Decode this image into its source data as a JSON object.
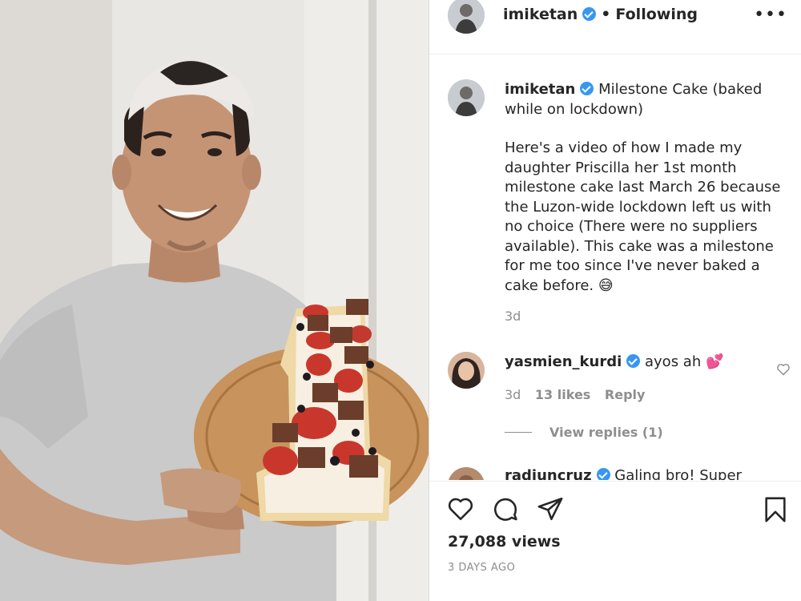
{
  "post": {
    "username": "imiketan",
    "follow_status": "Following",
    "more_icon": "more-options-icon"
  },
  "caption": {
    "username": "imiketan",
    "title": "Milestone Cake (baked while on lockdown)",
    "body": "Here's a video of how I made my daughter Priscilla her 1st month milestone cake last March 26 because the Luzon-wide lockdown left us with no choice (There were no suppliers available). This cake was a milestone for me too since I've never baked a cake before. 😅",
    "time": "3d"
  },
  "comments": [
    {
      "username": "yasmien_kurdi",
      "text": "ayos ah 💕",
      "time": "3d",
      "likes": "13 likes",
      "reply_label": "Reply",
      "view_replies": "View replies (1)"
    },
    {
      "username": "radjuncruz",
      "text": "Galing bro! Super"
    }
  ],
  "footer": {
    "views": "27,088 views",
    "posted": "3 DAYS AGO"
  },
  "colors": {
    "verified": "#3897f0",
    "muted": "#8e8e8e",
    "text": "#262626"
  }
}
